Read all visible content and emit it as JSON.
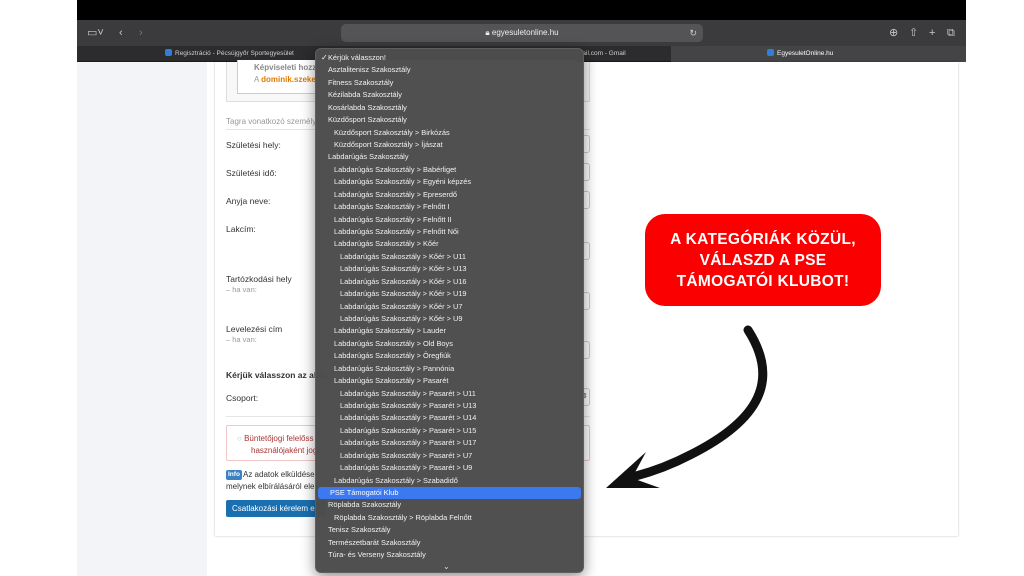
{
  "browser": {
    "address": "egyesuletonline.hu",
    "tabs": [
      {
        "label": "Regisztráció - Pécsújgyőr Sportegyesület",
        "active": false
      },
      {
        "label": "mail.com - Gmail",
        "active": false
      },
      {
        "label": "EgyesuletOnline.hu",
        "active": true
      }
    ]
  },
  "form": {
    "note_prefix": "Képviseleti hozz",
    "note_line2_prefix": "A ",
    "note_email": "dominik.szeke",
    "section_hint": "Tagra vonatkozó személye",
    "labels": {
      "birth_place": "Születési hely:",
      "birth_date": "Születési idő:",
      "mother_name": "Anyja neve:",
      "address": "Lakcím:",
      "residence": "Tartózkodási hely",
      "residence_sub": "– ha van:",
      "mailing": "Levelezési cím",
      "mailing_sub": "– ha van:",
      "choose": "Kérjük válasszon az aláb",
      "group": "Csoport:"
    },
    "alert_line1": "Büntetőjogi felelőss",
    "alert_line2": "használójaként jogo",
    "info_badge": "Info",
    "info_line1": "Az adatok elküldése",
    "info_line2": "melynek elbírálásáról elek",
    "submit_label": "Csatlakozási kérelem el"
  },
  "dropdown": {
    "options": [
      {
        "label": "Kérjük válasszon!",
        "indent": 0,
        "checked": true
      },
      {
        "label": "Asztalitenisz Szakosztály",
        "indent": 0
      },
      {
        "label": "Fitness Szakosztály",
        "indent": 0
      },
      {
        "label": "Kézilabda Szakosztály",
        "indent": 0
      },
      {
        "label": "Kosárlabda Szakosztály",
        "indent": 0
      },
      {
        "label": "Küzdősport Szakosztály",
        "indent": 0
      },
      {
        "label": "Küzdősport Szakosztály > Birkózás",
        "indent": 1
      },
      {
        "label": "Küzdősport Szakosztály > Íjászat",
        "indent": 1
      },
      {
        "label": "Labdarúgás Szakosztály",
        "indent": 0
      },
      {
        "label": "Labdarúgás Szakosztály > Babérliget",
        "indent": 1
      },
      {
        "label": "Labdarúgás Szakosztály > Egyéni képzés",
        "indent": 1
      },
      {
        "label": "Labdarúgás Szakosztály > Epreserdő",
        "indent": 1
      },
      {
        "label": "Labdarúgás Szakosztály > Felnőtt I",
        "indent": 1
      },
      {
        "label": "Labdarúgás Szakosztály > Felnőtt II",
        "indent": 1
      },
      {
        "label": "Labdarúgás Szakosztály > Felnőtt Női",
        "indent": 1
      },
      {
        "label": "Labdarúgás Szakosztály > Kőér",
        "indent": 1
      },
      {
        "label": "Labdarúgás Szakosztály > Kőér > U11",
        "indent": 2
      },
      {
        "label": "Labdarúgás Szakosztály > Kőér > U13",
        "indent": 2
      },
      {
        "label": "Labdarúgás Szakosztály > Kőér > U16",
        "indent": 2
      },
      {
        "label": "Labdarúgás Szakosztály > Kőér > U19",
        "indent": 2
      },
      {
        "label": "Labdarúgás Szakosztály > Kőér > U7",
        "indent": 2
      },
      {
        "label": "Labdarúgás Szakosztály > Kőér > U9",
        "indent": 2
      },
      {
        "label": "Labdarúgás Szakosztály > Lauder",
        "indent": 1
      },
      {
        "label": "Labdarúgás Szakosztály > Old Boys",
        "indent": 1
      },
      {
        "label": "Labdarúgás Szakosztály > Öregfiúk",
        "indent": 1
      },
      {
        "label": "Labdarúgás Szakosztály > Pannónia",
        "indent": 1
      },
      {
        "label": "Labdarúgás Szakosztály > Pasarét",
        "indent": 1
      },
      {
        "label": "Labdarúgás Szakosztály > Pasarét > U11",
        "indent": 2
      },
      {
        "label": "Labdarúgás Szakosztály > Pasarét > U13",
        "indent": 2
      },
      {
        "label": "Labdarúgás Szakosztály > Pasarét > U14",
        "indent": 2
      },
      {
        "label": "Labdarúgás Szakosztály > Pasarét > U15",
        "indent": 2
      },
      {
        "label": "Labdarúgás Szakosztály > Pasarét > U17",
        "indent": 2
      },
      {
        "label": "Labdarúgás Szakosztály > Pasarét > U7",
        "indent": 2
      },
      {
        "label": "Labdarúgás Szakosztály > Pasarét > U9",
        "indent": 2
      },
      {
        "label": "Labdarúgás Szakosztály > Szabadidő",
        "indent": 1
      },
      {
        "label": "PSE Támogatói Klub",
        "indent": 0,
        "highlighted": true
      },
      {
        "label": "Röplabda Szakosztály",
        "indent": 0
      },
      {
        "label": "Röplabda Szakosztály > Röplabda Felnőtt",
        "indent": 1
      },
      {
        "label": "Tenisz Szakosztály",
        "indent": 0
      },
      {
        "label": "Természetbarát Szakosztály",
        "indent": 0
      },
      {
        "label": "Túra- és Verseny Szakosztály",
        "indent": 0
      }
    ]
  },
  "callout": {
    "text": "A KATEGÓRIÁK KÖZÜL, VÁLASZD A PSE TÁMOGATÓI KLUBOT!",
    "color": "#fa0000"
  },
  "colors": {
    "highlight": "#3c79f0",
    "arrow": "#111111"
  }
}
